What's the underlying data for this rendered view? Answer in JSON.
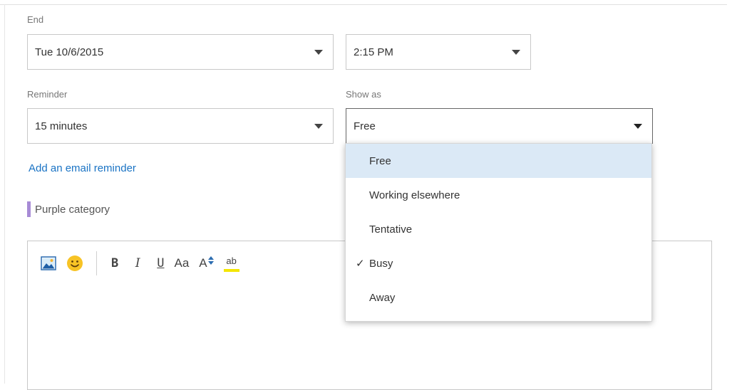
{
  "end": {
    "label": "End",
    "date_value": "Tue 10/6/2015",
    "time_value": "2:15 PM"
  },
  "reminder": {
    "label": "Reminder",
    "value": "15 minutes"
  },
  "show_as": {
    "label": "Show as",
    "value": "Free",
    "options": [
      {
        "label": "Free",
        "highlighted": true,
        "checked": false
      },
      {
        "label": "Working elsewhere",
        "highlighted": false,
        "checked": false
      },
      {
        "label": "Tentative",
        "highlighted": false,
        "checked": false
      },
      {
        "label": "Busy",
        "highlighted": false,
        "checked": true
      },
      {
        "label": "Away",
        "highlighted": false,
        "checked": false
      }
    ],
    "check_glyph": "✓"
  },
  "email_reminder_link": "Add an email reminder",
  "category": {
    "label": "Purple category",
    "color": "#a78bd6"
  },
  "toolbar": {
    "bold": "B",
    "italic": "I",
    "underline": "U",
    "font_size": "Aa",
    "grow_font": "A",
    "highlight": "ab"
  },
  "colors": {
    "accent_link": "#1a73c4",
    "menu_highlight": "#dbe9f6",
    "emoji": "#f7c325"
  }
}
